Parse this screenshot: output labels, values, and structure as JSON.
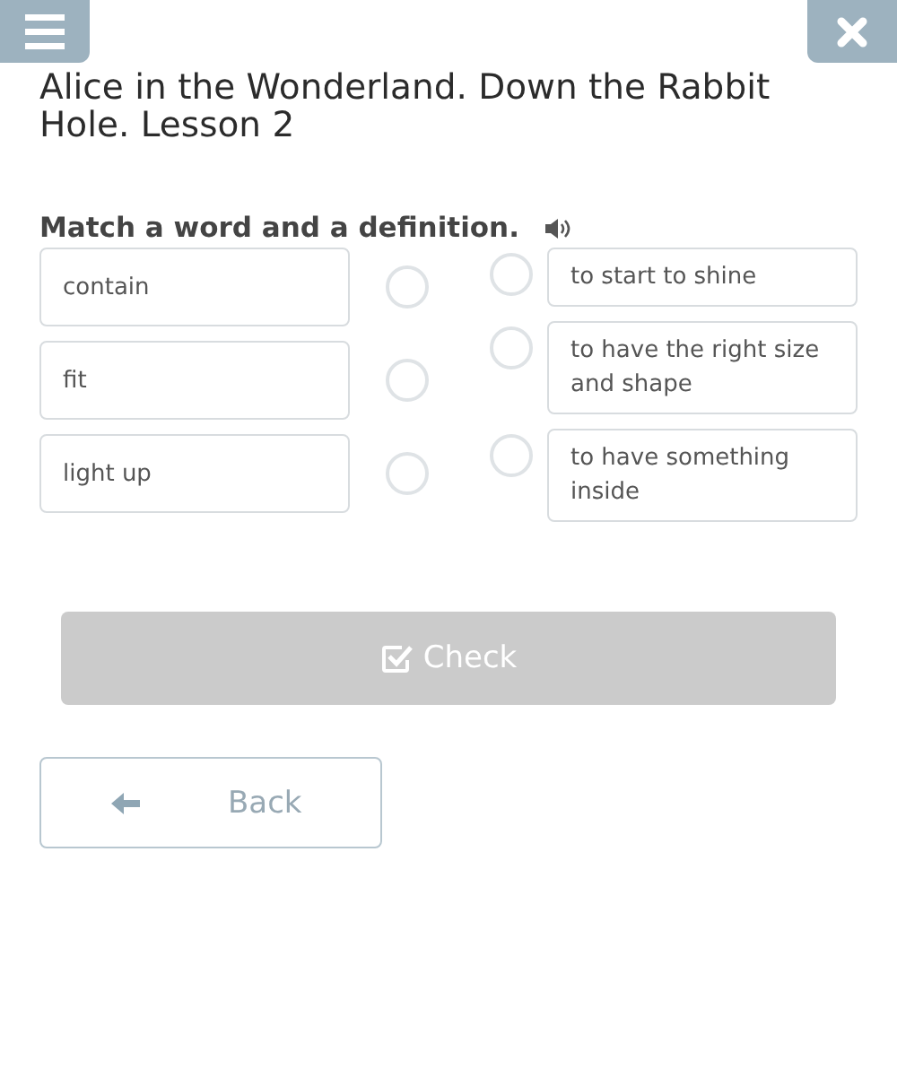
{
  "title": "Alice in the Wonderland. Down the Rabbit Hole. Lesson 2",
  "instruction": "Match a word and a definition.",
  "words": [
    {
      "text": "contain"
    },
    {
      "text": "fit"
    },
    {
      "text": "light up"
    }
  ],
  "definitions": [
    {
      "text": "to start to shine"
    },
    {
      "text": "to have the right size and shape"
    },
    {
      "text": "to have something inside"
    }
  ],
  "check_button": {
    "label": "Check",
    "disabled": true
  },
  "back_button": {
    "label": "Back"
  }
}
